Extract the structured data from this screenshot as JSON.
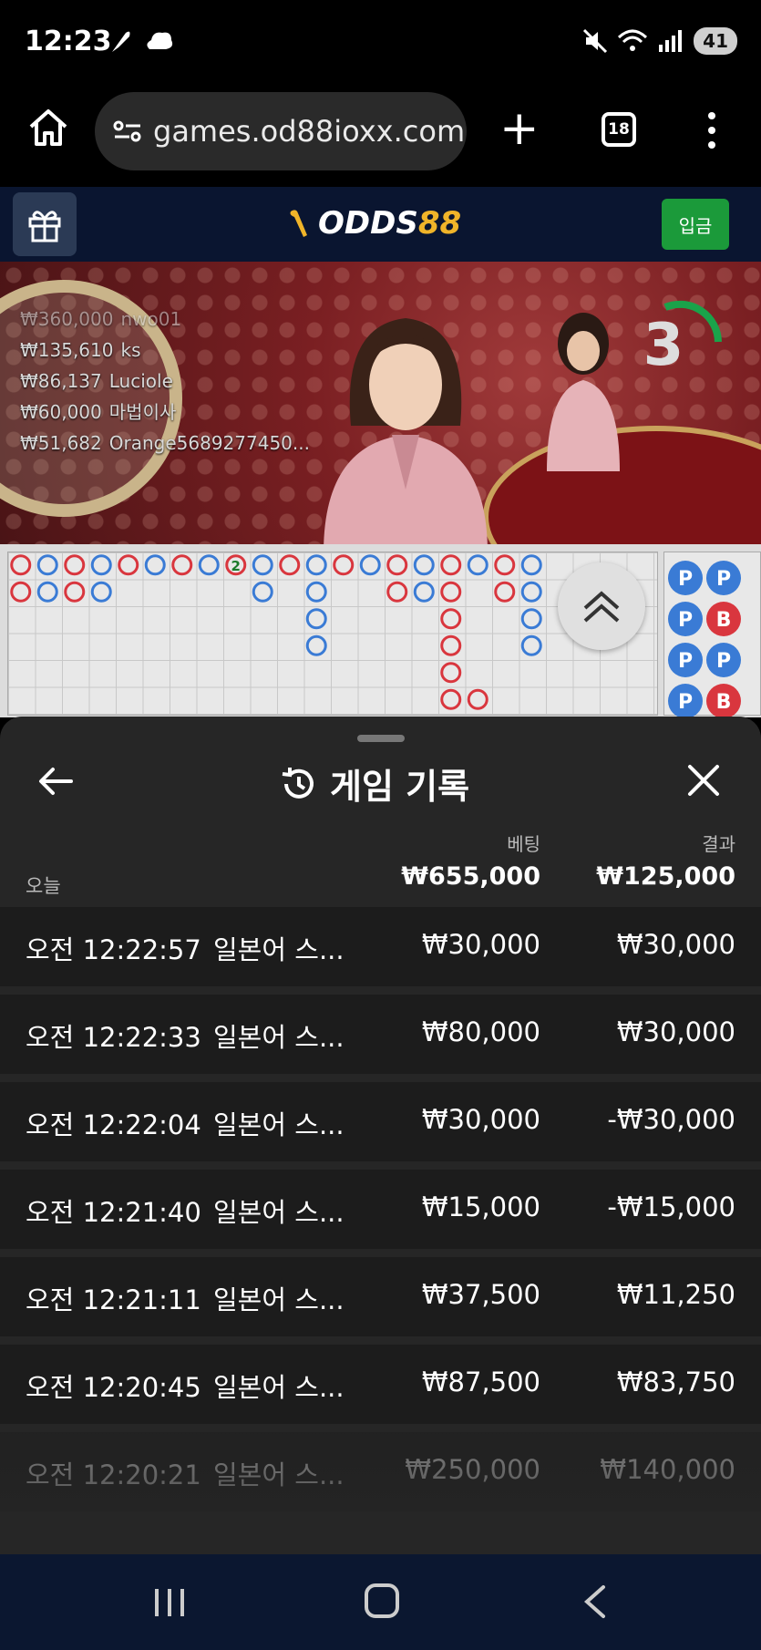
{
  "status_bar": {
    "time": "12:23",
    "battery": "41"
  },
  "browser": {
    "url": "games.od88ioxx.com",
    "tab_count": "18"
  },
  "site": {
    "logo_text": "ODDS",
    "logo_accent": "88",
    "deposit_label": "입금"
  },
  "leaderboard": [
    {
      "amount": "₩360,000",
      "name": "nwo01"
    },
    {
      "amount": "₩135,610",
      "name": "ks"
    },
    {
      "amount": "₩86,137",
      "name": "Luciole"
    },
    {
      "amount": "₩60,000",
      "name": "마법이사"
    },
    {
      "amount": "₩51,682",
      "name": "Orange5689277450..."
    }
  ],
  "countdown": "3",
  "history": {
    "title": "게임 기록",
    "bet_header": "베팅",
    "result_header": "결과",
    "today_label": "오늘",
    "total_bet": "₩655,000",
    "total_result": "₩125,000",
    "rows": [
      {
        "time": "오전 12:22:57",
        "game": "일본어 스...",
        "bet": "₩30,000",
        "result": "₩30,000"
      },
      {
        "time": "오전 12:22:33",
        "game": "일본어 스...",
        "bet": "₩80,000",
        "result": "₩30,000"
      },
      {
        "time": "오전 12:22:04",
        "game": "일본어 스...",
        "bet": "₩30,000",
        "result": "-₩30,000"
      },
      {
        "time": "오전 12:21:40",
        "game": "일본어 스...",
        "bet": "₩15,000",
        "result": "-₩15,000"
      },
      {
        "time": "오전 12:21:11",
        "game": "일본어 스...",
        "bet": "₩37,500",
        "result": "₩11,250"
      },
      {
        "time": "오전 12:20:45",
        "game": "일본어 스...",
        "bet": "₩87,500",
        "result": "₩83,750"
      },
      {
        "time": "오전 12:20:21",
        "game": "일본어 스...",
        "bet": "₩250,000",
        "result": "₩140,000"
      }
    ]
  },
  "colors": {
    "banker": "#d9363e",
    "player": "#3a7bd5",
    "deposit": "#1b9a3a",
    "logo_accent": "#f0b429"
  },
  "roadmap": {
    "tie_label": "2",
    "side_beads": [
      "P",
      "P",
      "P",
      "P",
      "P",
      "B",
      "P",
      "B"
    ]
  }
}
